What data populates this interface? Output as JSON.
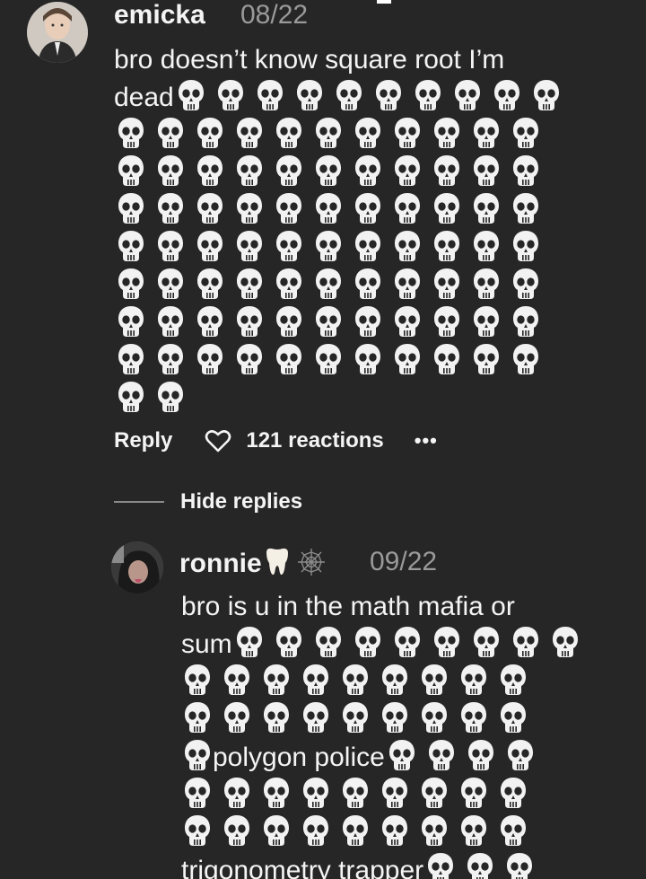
{
  "comment": {
    "username": "emicka",
    "date": "08/22",
    "text_line1": "bro doesn’t know square root I’m",
    "text_line2_word": "dead",
    "reply_label": "Reply",
    "reactions_label": "121 reactions",
    "more_label": "•••"
  },
  "replies_toggle": {
    "label": "Hide replies"
  },
  "reply": {
    "username": "ronnie",
    "date": "09/22",
    "text_line1": "bro is u in the math mafia or",
    "text_line2_word": "sum",
    "phrase_polygon": "polygon police",
    "phrase_trig": "trigonometry trapper"
  },
  "icons": {
    "skull": "skull-emoji",
    "tooth": "tooth-emoji",
    "web": "spider-web-emoji",
    "heart": "heart-outline-icon"
  },
  "colors": {
    "background": "#262626",
    "text": "#f4f4f4",
    "muted": "#9a9a9a"
  }
}
